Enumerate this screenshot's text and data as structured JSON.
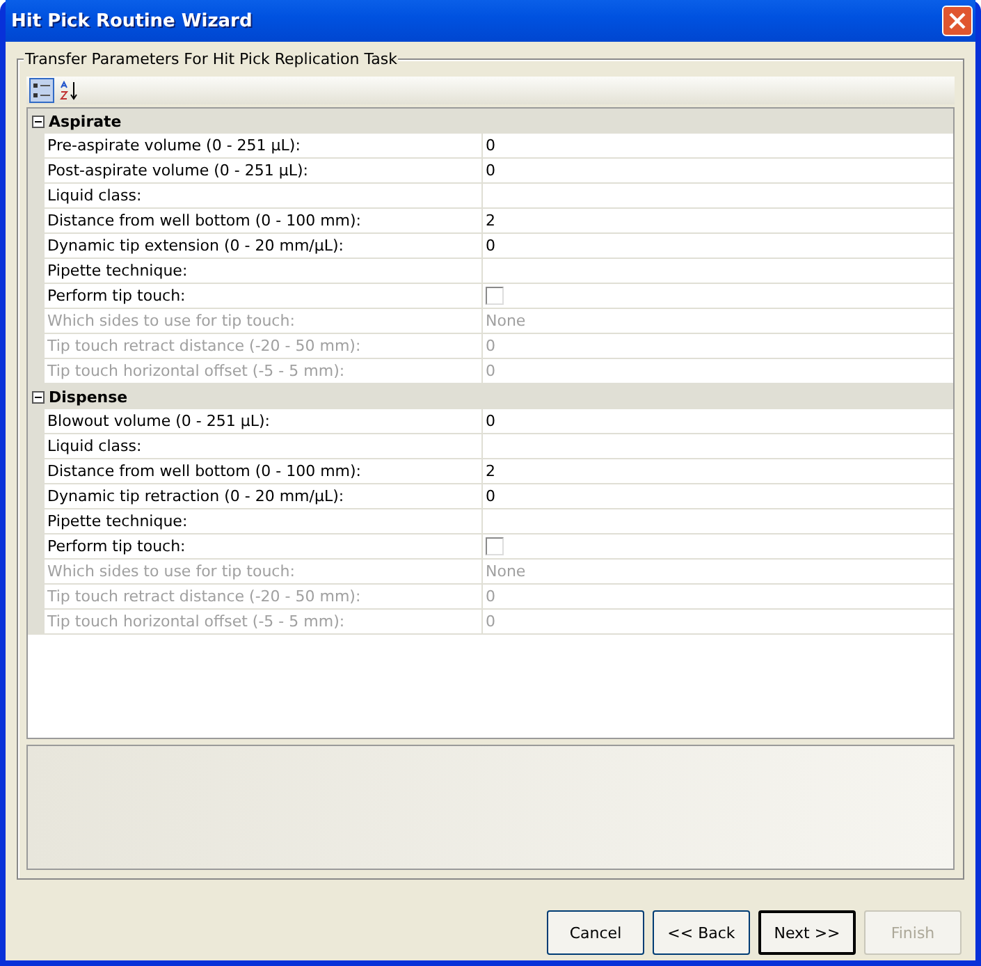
{
  "window": {
    "title": "Hit Pick Routine Wizard"
  },
  "group": {
    "title": "Transfer Parameters For Hit Pick Replication Task"
  },
  "toolbar": [
    {
      "kind": "categorized",
      "selected": true
    },
    {
      "kind": "alphabetical",
      "selected": false
    }
  ],
  "categories": [
    {
      "name": "Aspirate",
      "expanded": true,
      "properties": [
        {
          "label": "Pre-aspirate volume (0 - 251 µL):",
          "kind": "text",
          "value": "0",
          "disabled": false
        },
        {
          "label": "Post-aspirate volume (0 - 251 µL):",
          "kind": "text",
          "value": "0",
          "disabled": false
        },
        {
          "label": "Liquid class:",
          "kind": "text",
          "disabled": false
        },
        {
          "label": "Distance from well bottom (0 - 100 mm):",
          "kind": "text",
          "value": "2",
          "disabled": false
        },
        {
          "label": "Dynamic tip extension (0 - 20 mm/µL):",
          "kind": "text",
          "value": "0",
          "disabled": false
        },
        {
          "label": "Pipette technique:",
          "kind": "text",
          "disabled": false
        },
        {
          "label": "Perform tip touch:",
          "kind": "checkbox",
          "checked": false,
          "disabled": false
        },
        {
          "label": "Which sides to use for tip touch:",
          "kind": "text",
          "value": "None",
          "disabled": true
        },
        {
          "label": "Tip touch retract distance (-20 - 50 mm):",
          "kind": "text",
          "value": "0",
          "disabled": true
        },
        {
          "label": "Tip touch horizontal offset (-5 - 5 mm):",
          "kind": "text",
          "value": "0",
          "disabled": true
        }
      ]
    },
    {
      "name": "Dispense",
      "expanded": true,
      "properties": [
        {
          "label": "Blowout volume (0 - 251 µL):",
          "kind": "text",
          "value": "0",
          "disabled": false
        },
        {
          "label": "Liquid class:",
          "kind": "text",
          "disabled": false
        },
        {
          "label": "Distance from well bottom (0 - 100 mm):",
          "kind": "text",
          "value": "2",
          "disabled": false
        },
        {
          "label": "Dynamic tip retraction (0 - 20 mm/µL):",
          "kind": "text",
          "value": "0",
          "disabled": false
        },
        {
          "label": "Pipette technique:",
          "kind": "text",
          "disabled": false
        },
        {
          "label": "Perform tip touch:",
          "kind": "checkbox",
          "checked": false,
          "disabled": false
        },
        {
          "label": "Which sides to use for tip touch:",
          "kind": "text",
          "value": "None",
          "disabled": true
        },
        {
          "label": "Tip touch retract distance (-20 - 50 mm):",
          "kind": "text",
          "value": "0",
          "disabled": true
        },
        {
          "label": "Tip touch horizontal offset (-5 - 5 mm):",
          "kind": "text",
          "value": "0",
          "disabled": true
        }
      ]
    }
  ],
  "buttons": [
    {
      "label": "Cancel",
      "default": false,
      "disabled": false
    },
    {
      "label": "<< Back",
      "default": false,
      "disabled": false
    },
    {
      "label": "Next >>",
      "default": true,
      "disabled": false
    },
    {
      "label": "Finish",
      "default": false,
      "disabled": true
    }
  ]
}
